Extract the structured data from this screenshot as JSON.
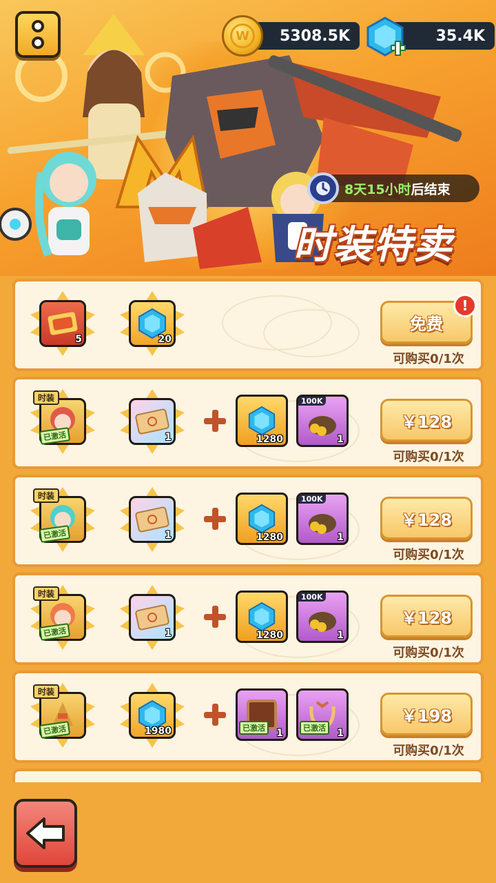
{
  "header": {
    "gold_amount": "5308.5K",
    "gem_amount": "35.4K"
  },
  "banner": {
    "timer_number": "8天15小时",
    "timer_suffix": "后结束",
    "title": "时装特卖"
  },
  "rows": [
    {
      "items": [
        {
          "qty": "5"
        },
        {
          "qty": "20"
        }
      ],
      "button": "免费",
      "limit": "可购买0/1次"
    },
    {
      "skin_tag": "时装",
      "active_tag": "已激活",
      "ticket_qty": "1",
      "gem_qty": "1280",
      "bag_badge": "100K",
      "bag_qty": "1",
      "button": "￥128",
      "limit": "可购买0/1次"
    },
    {
      "skin_tag": "时装",
      "active_tag": "已激活",
      "ticket_qty": "1",
      "gem_qty": "1280",
      "bag_badge": "100K",
      "bag_qty": "1",
      "button": "￥128",
      "limit": "可购买0/1次"
    },
    {
      "skin_tag": "时装",
      "active_tag": "已激活",
      "ticket_qty": "1",
      "gem_qty": "1280",
      "bag_badge": "100K",
      "bag_qty": "1",
      "button": "￥128",
      "limit": "可购买0/1次"
    },
    {
      "skin_tag": "时装",
      "active_tag": "已激活",
      "gem_qty": "1980",
      "frame_tag": "已激活",
      "frame_qty": "1",
      "crest_tag": "已激活",
      "crest_qty": "1",
      "button": "￥198",
      "limit": "可购买0/1次"
    }
  ],
  "colors": {
    "background": "#f3a83a",
    "timer_highlight": "#9cf06a",
    "row_border": "#e79a36"
  }
}
